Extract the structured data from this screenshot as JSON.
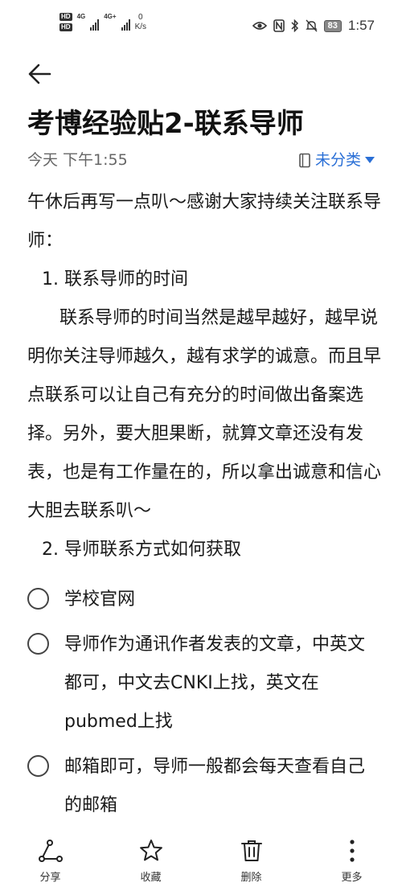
{
  "status_bar": {
    "hd1": "HD",
    "hd2": "HD",
    "net1": "4G",
    "net2": "4G+",
    "speed_value": "0",
    "speed_unit": "K/s",
    "battery": "83",
    "time": "1:57"
  },
  "note": {
    "title": "考博经验贴2-联系导师",
    "date": "今天 下午1:55",
    "category": "未分类",
    "intro": "午休后再写一点叭～感谢大家持续关注联系导师：",
    "section1_heading": "1. 联系导师的时间",
    "section1_body": "联系导师的时间当然是越早越好，越早说明你关注导师越久，越有求学的诚意。而且早点联系可以让自己有充分的时间做出备案选择。另外，要大胆果断，就算文章还没有发表，也是有工作量在的，所以拿出诚意和信心大胆去联系叭～",
    "section2_heading": "2. 导师联系方式如何获取",
    "checklist": [
      {
        "text": "学校官网",
        "checked": false
      },
      {
        "text": "导师作为通讯作者发表的文章，中英文都可，中文去CNKI上找，英文在pubmed上找",
        "checked": false
      },
      {
        "text": "邮箱即可，导师一般都会每天查看自己的邮箱",
        "checked": false
      }
    ]
  },
  "toolbar": {
    "share": "分享",
    "favorite": "收藏",
    "delete": "删除",
    "more": "更多"
  },
  "icons": {
    "back": "arrow-left-icon",
    "share": "share-icon",
    "favorite": "star-icon",
    "delete": "trash-icon",
    "more": "more-vertical-icon",
    "category": "notebook-icon"
  },
  "colors": {
    "accent": "#2a6fd6",
    "text": "#1a1a1a",
    "muted": "#666666"
  }
}
